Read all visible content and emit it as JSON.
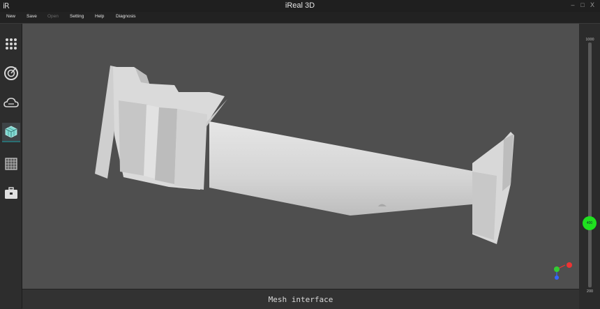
{
  "app": {
    "logo": "iR",
    "title": "iReal 3D"
  },
  "window_buttons": [
    "–",
    "□",
    "X"
  ],
  "menu": [
    {
      "label": "New",
      "enabled": true
    },
    {
      "label": "Save",
      "enabled": true
    },
    {
      "label": "Open",
      "enabled": false
    },
    {
      "label": "Setting",
      "enabled": true
    },
    {
      "label": "Help",
      "enabled": true
    },
    {
      "label": "Diagnosis",
      "enabled": true
    }
  ],
  "sidebar": {
    "items": [
      {
        "icon": "dot-grid-icon",
        "active": false
      },
      {
        "icon": "target-icon",
        "active": false
      },
      {
        "icon": "cloud-icon",
        "active": false
      },
      {
        "icon": "mesh-cube-icon",
        "active": true
      },
      {
        "icon": "grid-icon",
        "active": false
      },
      {
        "icon": "toolbox-icon",
        "active": false
      }
    ]
  },
  "status": {
    "text": "Mesh interface"
  },
  "slider": {
    "max_label": "1000",
    "min_label": "200",
    "value_label": "400",
    "value": 400,
    "min": 200,
    "max": 1000
  },
  "colors": {
    "accent": "#1fe01f",
    "viewport": "#4f4f4f",
    "model": "#d9d9d9"
  }
}
